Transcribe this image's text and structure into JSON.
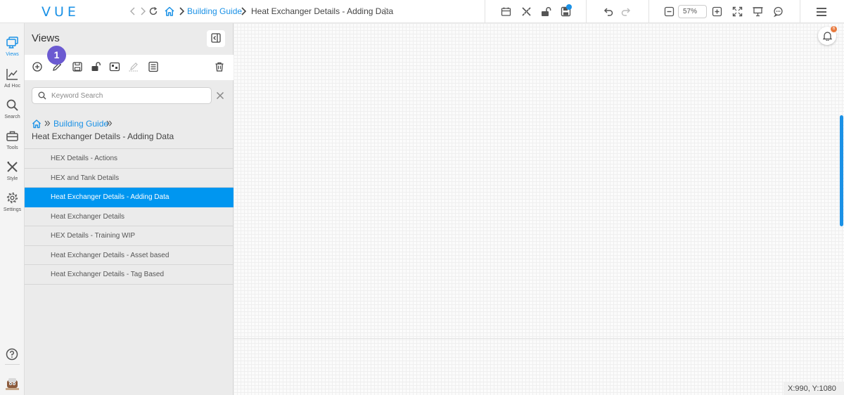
{
  "app": {
    "logo": "VUE"
  },
  "header": {
    "breadcrumb": {
      "parent": "Building Guide",
      "current": "Heat Exchanger Details - Adding Data"
    },
    "zoom": "57%",
    "icons": [
      "back-icon",
      "forward-icon",
      "refresh-icon",
      "home-icon",
      "calendar-icon",
      "design-tools-icon",
      "unlock-icon",
      "save-icon",
      "undo-icon",
      "redo-icon",
      "zoom-out-icon",
      "zoom-in-icon",
      "fit-screen-icon",
      "presentation-icon",
      "comments-icon",
      "menu-icon"
    ]
  },
  "rail": {
    "items": [
      {
        "label": "Views",
        "icon": "views-icon",
        "active": true
      },
      {
        "label": "Ad Hoc",
        "icon": "chart-icon"
      },
      {
        "label": "Search",
        "icon": "search-icon"
      },
      {
        "label": "Tools",
        "icon": "toolbox-icon"
      },
      {
        "label": "Style",
        "icon": "style-icon"
      },
      {
        "label": "Settings",
        "icon": "gear-icon"
      }
    ],
    "bottom_icons": [
      "help-icon",
      "avatar"
    ]
  },
  "panel": {
    "title": "Views",
    "step_badge": "1",
    "search": {
      "placeholder": "Keyword Search",
      "value": ""
    },
    "breadcrumb": {
      "parent": "Building Guide",
      "current": "Heat Exchanger Details - Adding Data"
    },
    "views": [
      {
        "label": "HEX Details - Actions",
        "active": false
      },
      {
        "label": "HEX and Tank Details",
        "active": false
      },
      {
        "label": "Heat Exchanger Details - Adding Data",
        "active": true
      },
      {
        "label": "Heat Exchanger Details",
        "active": false
      },
      {
        "label": "HEX Details - Training WIP",
        "active": false
      },
      {
        "label": "Heat Exchanger Details - Asset based",
        "active": false
      },
      {
        "label": "Heat Exchanger Details - Tag Based",
        "active": false
      }
    ]
  },
  "canvas": {
    "notifications": "6",
    "coordinates": "X:990, Y:1080"
  },
  "colors": {
    "accent": "#1a91e6",
    "selected": "#0096f0",
    "badge": "#6b5ad1",
    "notification": "#e87a3f"
  }
}
